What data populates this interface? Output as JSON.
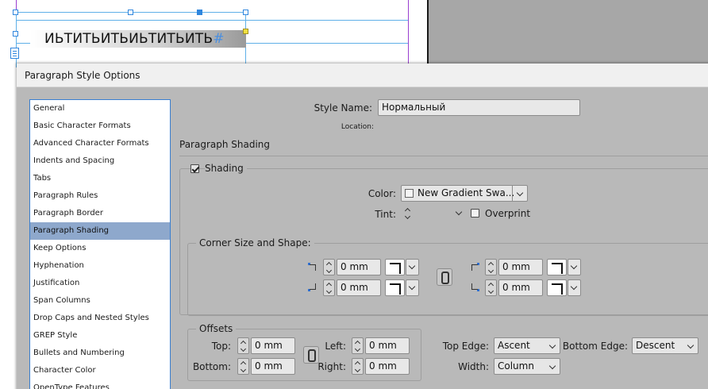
{
  "canvas": {
    "frame_text": "ИЬТИТЬИТЬИЬТИТЬИТЬ",
    "frame_text_marker": "#"
  },
  "dialog": {
    "title": "Paragraph Style Options"
  },
  "categories": [
    {
      "label": "General",
      "selected": false
    },
    {
      "label": "Basic Character Formats",
      "selected": false
    },
    {
      "label": "Advanced Character Formats",
      "selected": false
    },
    {
      "label": "Indents and Spacing",
      "selected": false
    },
    {
      "label": "Tabs",
      "selected": false
    },
    {
      "label": "Paragraph Rules",
      "selected": false
    },
    {
      "label": "Paragraph Border",
      "selected": false
    },
    {
      "label": "Paragraph Shading",
      "selected": true
    },
    {
      "label": "Keep Options",
      "selected": false
    },
    {
      "label": "Hyphenation",
      "selected": false
    },
    {
      "label": "Justification",
      "selected": false
    },
    {
      "label": "Span Columns",
      "selected": false
    },
    {
      "label": "Drop Caps and Nested Styles",
      "selected": false
    },
    {
      "label": "GREP Style",
      "selected": false
    },
    {
      "label": "Bullets and Numbering",
      "selected": false
    },
    {
      "label": "Character Color",
      "selected": false
    },
    {
      "label": "OpenType Features",
      "selected": false
    }
  ],
  "style": {
    "name_label": "Style Name:",
    "name_value": "Нормальный",
    "location_label": "Location:"
  },
  "section": {
    "title": "Paragraph Shading"
  },
  "shading": {
    "checkbox_label": "Shading",
    "checked": true,
    "color_label": "Color:",
    "color_value": "New Gradient Swa...",
    "tint_label": "Tint:",
    "tint_value": "",
    "overprint_label": "Overprint",
    "overprint_checked": false
  },
  "corners": {
    "title": "Corner Size and Shape:",
    "top_left": "0 mm",
    "bottom_left": "0 mm",
    "top_right": "0 mm",
    "bottom_right": "0 mm"
  },
  "offsets": {
    "title": "Offsets",
    "top_label": "Top:",
    "top_value": "0 mm",
    "bottom_label": "Bottom:",
    "bottom_value": "0 mm",
    "left_label": "Left:",
    "left_value": "0 mm",
    "right_label": "Right:",
    "right_value": "0 mm"
  },
  "edges": {
    "top_edge_label": "Top Edge:",
    "top_edge_value": "Ascent",
    "bottom_edge_label": "Bottom Edge:",
    "bottom_edge_value": "Descent",
    "width_label": "Width:",
    "width_value": "Column"
  }
}
